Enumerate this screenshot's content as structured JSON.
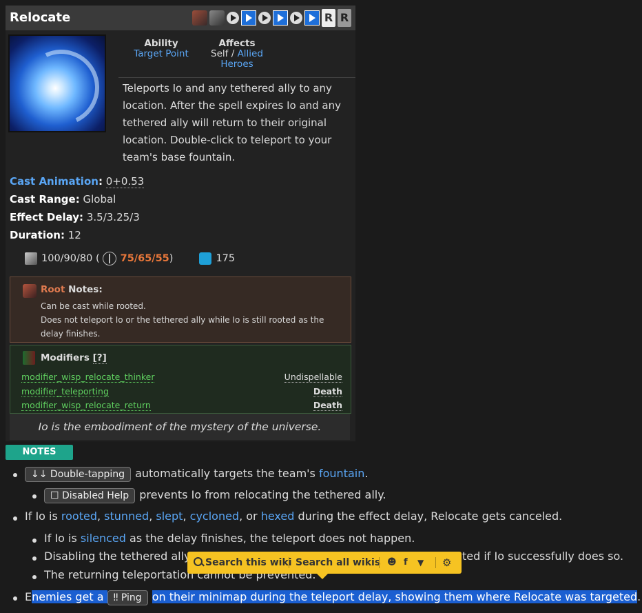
{
  "ability": {
    "title": "Relocate",
    "keys": [
      "R",
      "R"
    ],
    "meta": {
      "ability_label": "Ability",
      "ability_value": "Target Point",
      "affects_label": "Affects",
      "affects_self": "Self /",
      "affects_value1": "Allied",
      "affects_value2": "Heroes"
    },
    "description": "Teleports Io and any tethered ally to any location. After the spell expires Io and any tethered ally will return to their original location. Double-click to teleport to your team's base fountain.",
    "stats": {
      "cast_animation_label": "Cast Animation",
      "cast_animation_value": "0+0.53",
      "cast_range_label": "Cast Range:",
      "cast_range_value": "Global",
      "effect_delay_label": "Effect Delay:",
      "effect_delay_value": "3.5/3.25/3",
      "duration_label": "Duration:",
      "duration_value": "12"
    },
    "costs": {
      "cooldown_base": "100/90/80 (",
      "cooldown_talent": "75/65/55",
      "cooldown_close": ")",
      "mana": "175"
    },
    "root_notes": {
      "title_word": "Root",
      "title_rest": "Notes:",
      "line1": "Can be cast while rooted.",
      "line2": "Does not teleport Io or the tethered ally while Io is still rooted as the delay finishes."
    },
    "modifiers": {
      "title": "Modifiers",
      "help": "[?]",
      "rows": [
        {
          "name": "modifier_wisp_relocate_thinker",
          "tag": "Undispellable"
        },
        {
          "name": "modifier_teleporting",
          "tag": "Death"
        },
        {
          "name": "modifier_wisp_relocate_return",
          "tag": "Death"
        }
      ]
    },
    "lore": "Io is the embodiment of the mystery of the universe."
  },
  "notes": {
    "label": "NOTES",
    "n1_chip": "↓↓ Double-tapping",
    "n1_text": "automatically targets the team's",
    "n1_link": "fountain",
    "n1_end": ".",
    "n1a_chip": "☐ Disabled Help",
    "n1a_text": "prevents Io from relocating the tethered ally.",
    "n2_pre": "If Io is",
    "n2_l1": "rooted",
    "n2_l2": "stunned",
    "n2_l3": "slept",
    "n2_l4": "cycloned",
    "n2_l5": "hexed",
    "n2_sep": ",",
    "n2_or": ", or",
    "n2_post": "during the effect delay, Relocate gets canceled.",
    "n2a_pre": "If Io is",
    "n2a_link": "silenced",
    "n2a_post": "as the delay finishes, the teleport does not happen.",
    "n2b_left": "Disabling the tethered ally",
    "n2b_right": "ted if Io successfully does so.",
    "n2c": "The returning teleportation cannot be prevented.",
    "n3_first": "E",
    "n3_sel1": "nemies get a",
    "n3_chip": "‼ Ping",
    "n3_sel2": "on their minimap during the teleport delay, showing them where Relocate was targeted",
    "n3_end": "."
  },
  "search_popup": {
    "search_this": "Search this wiki",
    "search_all": "Search all wikis",
    "icons": [
      "reddit-icon",
      "facebook-icon",
      "twitter-icon",
      "gear-icon"
    ]
  }
}
